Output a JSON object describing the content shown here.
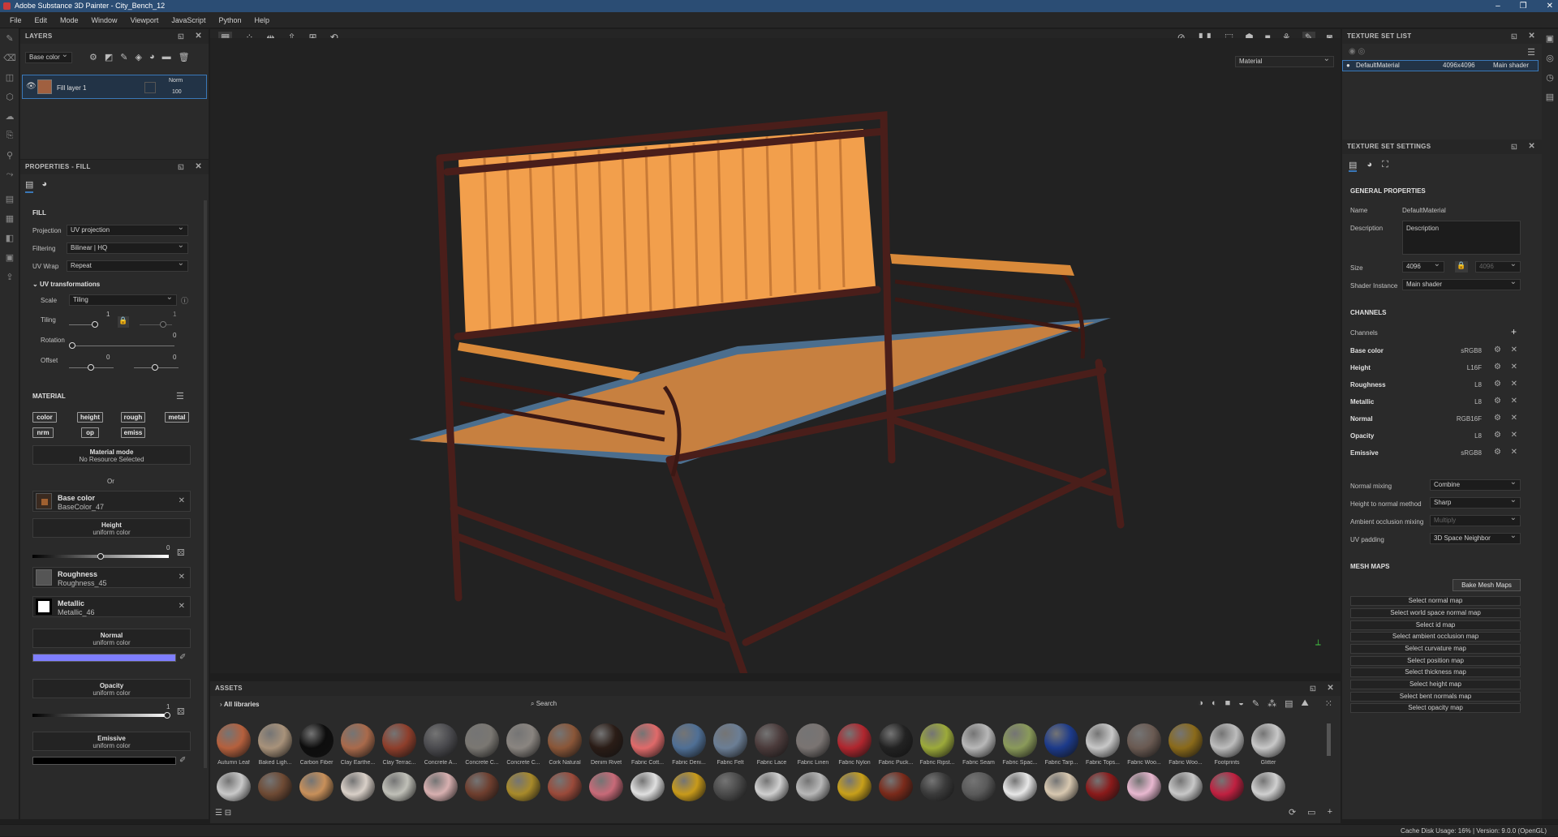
{
  "window": {
    "title": "Adobe Substance 3D Painter - City_Bench_12",
    "controls": [
      "–",
      "❐",
      "✕"
    ]
  },
  "menu": [
    "File",
    "Edit",
    "Mode",
    "Window",
    "Viewport",
    "JavaScript",
    "Python",
    "Help"
  ],
  "layers": {
    "title": "LAYERS",
    "channel_select": "Base color",
    "layer": {
      "name": "Fill layer 1",
      "blend": "Norm",
      "opacity": "100"
    }
  },
  "properties": {
    "title": "PROPERTIES - FILL",
    "fill_section": "FILL",
    "projection_label": "Projection",
    "projection_value": "UV projection",
    "filtering_label": "Filtering",
    "filtering_value": "Bilinear | HQ",
    "uvwrap_label": "UV Wrap",
    "uvwrap_value": "Repeat",
    "uvtransform_label": "UV transformations",
    "scale_label": "Scale",
    "scale_value": "Tiling",
    "tiling_label": "Tiling",
    "tiling_value": "1",
    "tiling_value2": "1",
    "rotation_label": "Rotation",
    "rotation_value": "0",
    "offset_label": "Offset",
    "offset_value1": "0",
    "offset_value2": "0",
    "material_section": "MATERIAL",
    "material_buttons": [
      "color",
      "height",
      "rough",
      "metal",
      "nrm",
      "op",
      "emiss"
    ],
    "material_mode_title": "Material mode",
    "material_mode_sub": "No Resource Selected",
    "or_label": "Or",
    "base_color_title": "Base color",
    "base_color_res": "BaseColor_47",
    "height_title": "Height",
    "height_sub": "uniform color",
    "height_value": "0",
    "roughness_title": "Roughness",
    "roughness_res": "Roughness_45",
    "metallic_title": "Metallic",
    "metallic_res": "Metallic_46",
    "normal_title": "Normal",
    "normal_sub": "uniform color",
    "opacity_title": "Opacity",
    "opacity_sub": "uniform color",
    "opacity_value": "1",
    "emissive_title": "Emissive",
    "emissive_sub": "uniform color"
  },
  "viewport": {
    "display_mode": "Material"
  },
  "texture_set_list": {
    "title": "TEXTURE SET LIST",
    "item_name": "DefaultMaterial",
    "item_size": "4096x4096",
    "item_shader": "Main shader"
  },
  "texture_set_settings": {
    "title": "TEXTURE SET SETTINGS",
    "general": "GENERAL PROPERTIES",
    "name_label": "Name",
    "name_value": "DefaultMaterial",
    "desc_label": "Description",
    "desc_value": "Description",
    "size_label": "Size",
    "size_value": "4096",
    "size_value2": "4096",
    "shader_label": "Shader Instance",
    "shader_value": "Main shader",
    "channels_section": "CHANNELS",
    "channels_label": "Channels",
    "channels": [
      {
        "name": "Base color",
        "format": "sRGB8"
      },
      {
        "name": "Height",
        "format": "L16F"
      },
      {
        "name": "Roughness",
        "format": "L8"
      },
      {
        "name": "Metallic",
        "format": "L8"
      },
      {
        "name": "Normal",
        "format": "RGB16F"
      },
      {
        "name": "Opacity",
        "format": "L8"
      },
      {
        "name": "Emissive",
        "format": "sRGB8"
      }
    ],
    "normal_mixing_label": "Normal mixing",
    "normal_mixing_value": "Combine",
    "h2n_label": "Height to normal method",
    "h2n_value": "Sharp",
    "ao_label": "Ambient occlusion mixing",
    "ao_value": "Multiply",
    "uvpad_label": "UV padding",
    "uvpad_value": "3D Space Neighbor",
    "meshmaps_section": "MESH MAPS",
    "bake_button": "Bake Mesh Maps",
    "select_maps": [
      "Select normal map",
      "Select world space normal map",
      "Select id map",
      "Select ambient occlusion map",
      "Select curvature map",
      "Select position map",
      "Select thickness map",
      "Select height map",
      "Select bent normals map",
      "Select opacity map"
    ]
  },
  "assets": {
    "title": "ASSETS",
    "library": "All libraries",
    "search_placeholder": "Search",
    "row1": [
      {
        "label": "Autumn Leaf",
        "color": "#b5603d"
      },
      {
        "label": "Baked Ligh...",
        "color": "#a8927a"
      },
      {
        "label": "Carbon Fiber",
        "color": "#0d0d0d"
      },
      {
        "label": "Clay Earthe...",
        "color": "#a96a4b"
      },
      {
        "label": "Clay Terrac...",
        "color": "#8e3e2b"
      },
      {
        "label": "Concrete A...",
        "color": "#4a4a4e"
      },
      {
        "label": "Concrete C...",
        "color": "#7a7772"
      },
      {
        "label": "Concrete C...",
        "color": "#8a8580"
      },
      {
        "label": "Cork Natural",
        "color": "#8a5638"
      },
      {
        "label": "Denim Rivet",
        "color": "#2a1c16"
      },
      {
        "label": "Fabric Cott...",
        "color": "#e06a6a"
      },
      {
        "label": "Fabric Deni...",
        "color": "#4f6f95"
      },
      {
        "label": "Fabric Felt",
        "color": "#6b7e95"
      },
      {
        "label": "Fabric Lace",
        "color": "#4a3a3a"
      },
      {
        "label": "Fabric Linen",
        "color": "#7a7472"
      },
      {
        "label": "Fabric Nylon",
        "color": "#b0262e"
      },
      {
        "label": "Fabric Puck...",
        "color": "#222222"
      },
      {
        "label": "Fabric Ripst...",
        "color": "#9caa3a"
      },
      {
        "label": "Fabric Seam",
        "color": "#b8b8b8"
      },
      {
        "label": "Fabric Spac...",
        "color": "#8a9a5a"
      },
      {
        "label": "Fabric Tarp...",
        "color": "#1c3a8a"
      },
      {
        "label": "Fabric Tops...",
        "color": "#c8c8c8"
      },
      {
        "label": "Fabric Woo...",
        "color": "#6a5a52"
      },
      {
        "label": "Fabric Woo...",
        "color": "#8a6a1a"
      },
      {
        "label": "Footprints",
        "color": "#bdbdbd"
      },
      {
        "label": "Glitter",
        "color": "#c8c8c8"
      }
    ],
    "row2_colors": [
      "#c9c9c9",
      "#6e4a34",
      "#c8905a",
      "#d9d0c8",
      "#c0c0b8",
      "#d8b0b0",
      "#6e3e2e",
      "#a88a2a",
      "#9a4a3a",
      "#c86a78",
      "#e0e0e0",
      "#c89a1a",
      "#4a4a4a",
      "#d0d0d0",
      "#b8b8b8",
      "#c8a01a",
      "#7a2a1a",
      "#3a3a3a",
      "#5a5a5a",
      "#e8e8e8",
      "#d8c8b0",
      "#8a1a1a",
      "#e8b8d0",
      "#c8c8c8",
      "#c02040",
      "#d0d0d0"
    ]
  },
  "status": {
    "text": "Cache Disk Usage:   16%  |  Version: 9.0.0 (OpenGL)"
  }
}
